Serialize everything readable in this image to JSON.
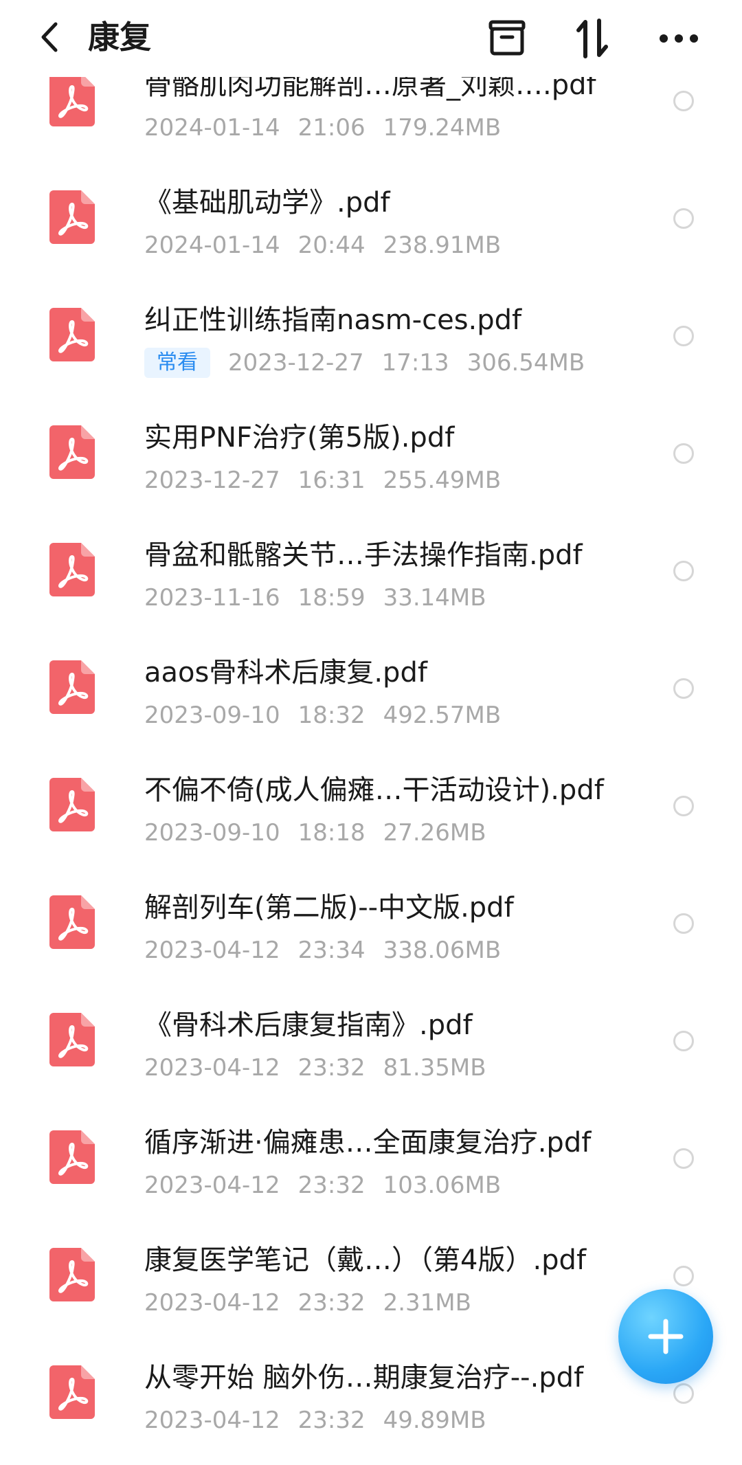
{
  "header": {
    "title": "康复",
    "back_icon": "chevron-left-icon",
    "archive_icon": "archive-icon",
    "sort_icon": "sort-icon",
    "more_icon": "more-icon"
  },
  "files": [
    {
      "name": "骨骼肌肉功能解剖…原著_刘颖….pdf",
      "date": "2024-01-14",
      "time": "21:06",
      "size": "179.24MB",
      "badge": ""
    },
    {
      "name": "《基础肌动学》.pdf",
      "date": "2024-01-14",
      "time": "20:44",
      "size": "238.91MB",
      "badge": ""
    },
    {
      "name": "纠正性训练指南nasm-ces.pdf",
      "date": "2023-12-27",
      "time": "17:13",
      "size": "306.54MB",
      "badge": "常看"
    },
    {
      "name": "实用PNF治疗(第5版).pdf",
      "date": "2023-12-27",
      "time": "16:31",
      "size": "255.49MB",
      "badge": ""
    },
    {
      "name": "骨盆和骶髂关节…手法操作指南.pdf",
      "date": "2023-11-16",
      "time": "18:59",
      "size": "33.14MB",
      "badge": ""
    },
    {
      "name": "aaos骨科术后康复.pdf",
      "date": "2023-09-10",
      "time": "18:32",
      "size": "492.57MB",
      "badge": ""
    },
    {
      "name": "不偏不倚(成人偏瘫…干活动设计).pdf",
      "date": "2023-09-10",
      "time": "18:18",
      "size": "27.26MB",
      "badge": ""
    },
    {
      "name": "解剖列车(第二版)--中文版.pdf",
      "date": "2023-04-12",
      "time": "23:34",
      "size": "338.06MB",
      "badge": ""
    },
    {
      "name": "《骨科术后康复指南》.pdf",
      "date": "2023-04-12",
      "time": "23:32",
      "size": "81.35MB",
      "badge": ""
    },
    {
      "name": "循序渐进·偏瘫患…全面康复治疗.pdf",
      "date": "2023-04-12",
      "time": "23:32",
      "size": "103.06MB",
      "badge": ""
    },
    {
      "name": "康复医学笔记（戴…）（第4版）.pdf",
      "date": "2023-04-12",
      "time": "23:32",
      "size": "2.31MB",
      "badge": ""
    },
    {
      "name": "从零开始 脑外伤…期康复治疗--.pdf",
      "date": "2023-04-12",
      "time": "23:32",
      "size": "49.89MB",
      "badge": ""
    }
  ],
  "fab": {
    "icon": "plus-icon"
  },
  "colors": {
    "pdf_icon": "#f2646a",
    "accent": "#2aa7f6",
    "meta": "#a8a8a8",
    "badge_text": "#2a8cf0"
  }
}
